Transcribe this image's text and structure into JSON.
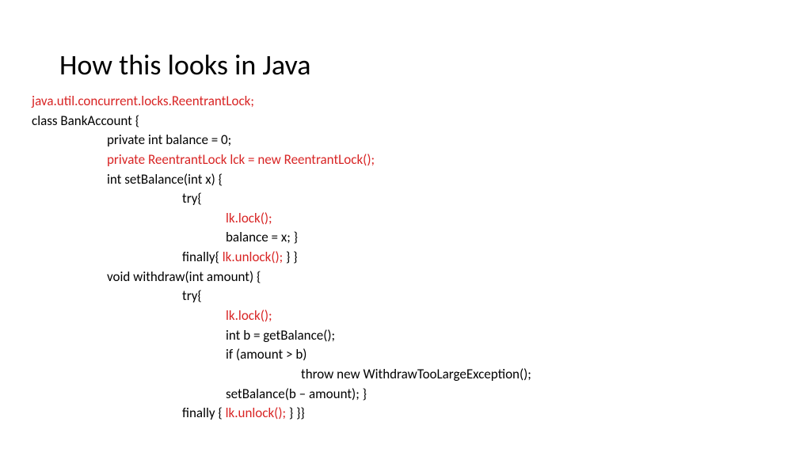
{
  "title": "How this looks in Java",
  "code": {
    "l1": "java.util.concurrent.locks.ReentrantLock;",
    "l2": "class BankAccount {",
    "l3": "private int balance = 0;",
    "l4": "private ReentrantLock lck = new ReentrantLock();",
    "l5": "int setBalance(int x) {",
    "l6": "try{",
    "l7": "lk.lock();",
    "l8": "balance = x; }",
    "l9a": "finally{ ",
    "l9b": "lk.unlock();",
    "l9c": " } }",
    "l10": "void withdraw(int amount) {",
    "l11": "try{",
    "l12": "lk.lock();",
    "l13": "int b = getBalance();",
    "l14": "if (amount > b)",
    "l15": "throw new WithdrawTooLargeException();",
    "l16": "setBalance(b – amount); }",
    "l17a": "finally { ",
    "l17b": "lk.unlock();",
    "l17c": " } }}"
  }
}
